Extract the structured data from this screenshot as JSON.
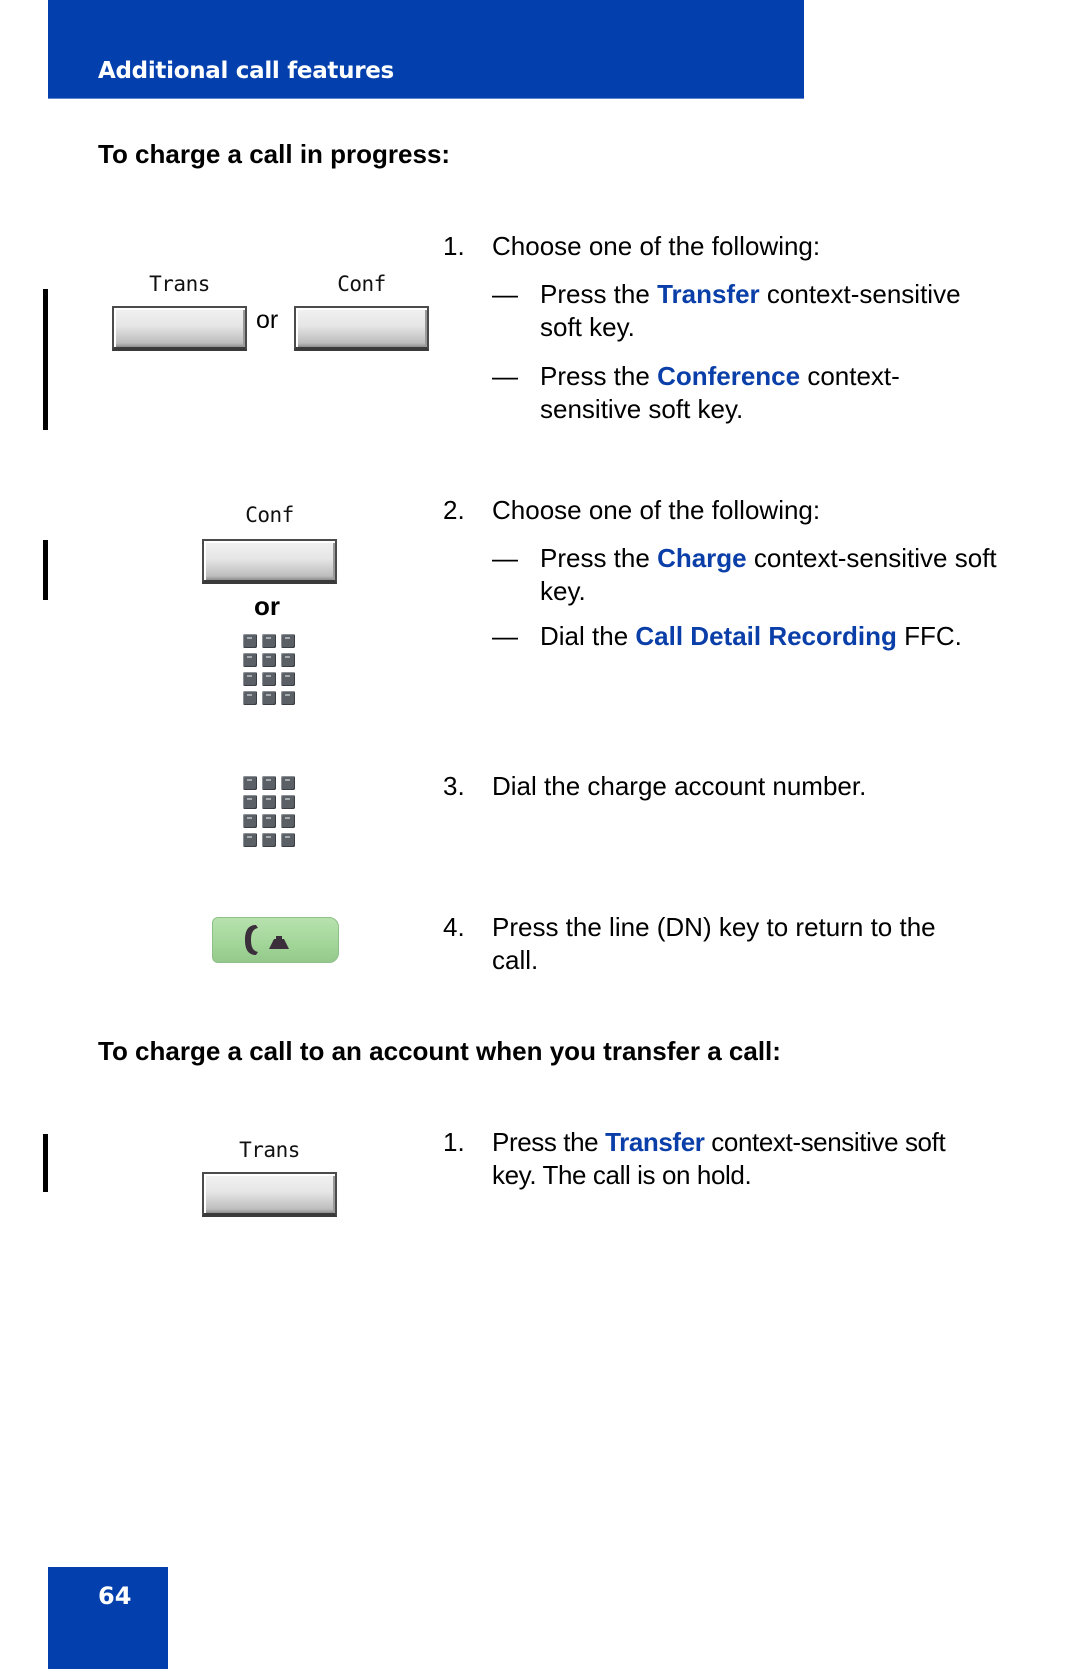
{
  "header": {
    "title": "Additional call features"
  },
  "colors": {
    "brand_blue": "#0340ad",
    "keyword_blue": "#0a3ea8",
    "line_key_green": "#a8d8a0"
  },
  "section1": {
    "heading": "To charge a call in progress:",
    "steps": [
      {
        "number": "1.",
        "text": "Choose one of the following:",
        "softkeys": [
          {
            "label": "Trans"
          },
          {
            "label": "Conf"
          }
        ],
        "or_label": "or",
        "options": [
          {
            "dash": "—",
            "pre": "Press the ",
            "keyword": "Transfer",
            "post": " context-sensitive soft key."
          },
          {
            "dash": "—",
            "pre": "Press the ",
            "keyword": "Conference",
            "post": " context-sensitive soft key."
          }
        ]
      },
      {
        "number": "2.",
        "text": "Choose one of the following:",
        "softkey": {
          "label": "Conf"
        },
        "or_label": "or",
        "keypad_icon": "dialpad-icon",
        "options": [
          {
            "dash": "—",
            "pre": "Press the ",
            "keyword": "Charge",
            "post": " context-sensitive soft key."
          },
          {
            "dash": "—",
            "pre": "Dial the ",
            "keyword": "Call Detail Recording",
            "post": " FFC."
          }
        ]
      },
      {
        "number": "3.",
        "text": "Dial the charge account number.",
        "keypad_icon": "dialpad-icon"
      },
      {
        "number": "4.",
        "text": "Press the line (DN) key to return to the call.",
        "line_key_icon": "line-key-handset-icon"
      }
    ]
  },
  "section2": {
    "heading": "To charge a call to an account when you transfer a call:",
    "steps": [
      {
        "number": "1.",
        "softkey": {
          "label": "Trans"
        },
        "pre": "Press the ",
        "keyword": "Transfer",
        "post": " context-sensitive soft key. The call is on hold."
      }
    ]
  },
  "footer": {
    "page_number": "64"
  }
}
